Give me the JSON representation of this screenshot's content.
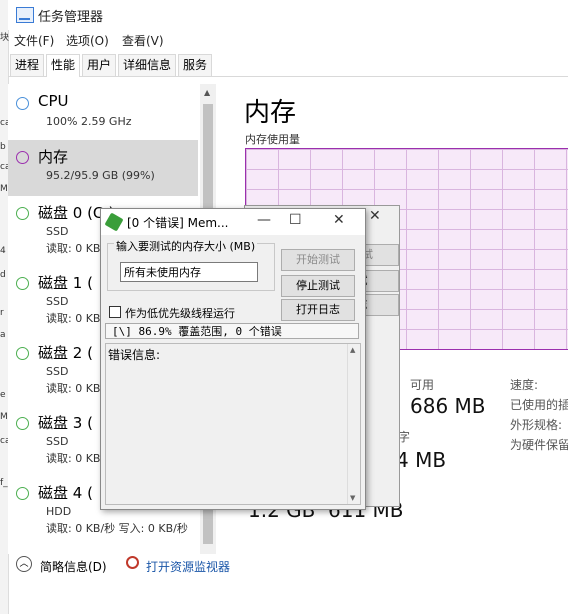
{
  "window": {
    "title": "任务管理器"
  },
  "menu": [
    "文件(F)",
    "选项(O)",
    "查看(V)"
  ],
  "tabs": [
    "进程",
    "性能",
    "用户",
    "详细信息",
    "服务"
  ],
  "left_strip": [
    "块",
    "ca",
    "b",
    "ca",
    "M",
    "4",
    "d",
    "r",
    "a",
    "e",
    "M",
    "ca",
    "f_"
  ],
  "perf_items": [
    {
      "name": "CPU",
      "sub": "100%  2.59 GHz",
      "sub2": ""
    },
    {
      "name": "内存",
      "sub": "95.2/95.9 GB (99%)",
      "sub2": ""
    },
    {
      "name": "磁盘 0 (C:)",
      "sub": "SSD",
      "sub2": "读取: 0 KB/秒"
    },
    {
      "name": "磁盘 1 (",
      "sub": "SSD",
      "sub2": "读取: 0 KB/秒"
    },
    {
      "name": "磁盘 2 (",
      "sub": "SSD",
      "sub2": "读取: 0 KB/秒"
    },
    {
      "name": "磁盘 3 (",
      "sub": "SSD",
      "sub2": "读取: 0 KB/秒"
    },
    {
      "name": "磁盘 4 (",
      "sub": "HDD",
      "sub2": "读取: 0 KB/秒  写入: 0 KB/秒"
    }
  ],
  "right": {
    "title": "内存",
    "usage_label": "内存使用量",
    "available_label": "可用",
    "available_value": "686 MB",
    "value_mid": "4 MB",
    "value_left_bottom": "1.2 GB",
    "value_mid_bottom": "611 MB",
    "speed_label": "速度:",
    "used_slots_label": "已使用的插",
    "form_factor_label": "外形规格:",
    "hw_reserved_label": "为硬件保留",
    "cut_label": "字"
  },
  "bottom": {
    "summary": "简略信息(D)",
    "monitor": "打开资源监视器"
  },
  "memtest": {
    "title": "[0 个错误] Mem...",
    "group_label": "输入要测试的内存大小 (MB)",
    "input_value": "所有未使用内存",
    "start_button": "开始测试",
    "stop_button": "停止测试",
    "log_button": "打开日志",
    "low_priority": "作为低优先级线程运行",
    "status": "[\\]   86.9% 覆盖范围, 0 个错误",
    "error_label": "错误信息:"
  },
  "memtest_back": {
    "start": "测试",
    "stop": "试",
    "log": "志"
  }
}
